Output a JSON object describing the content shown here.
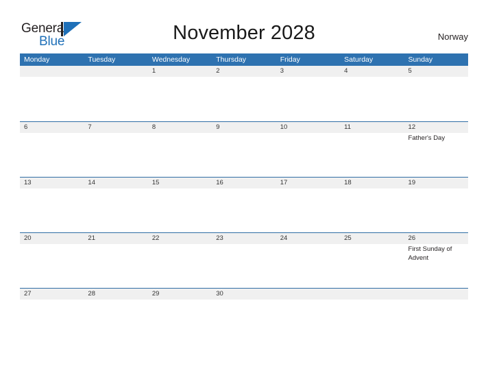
{
  "brand": {
    "name_part1": "General",
    "name_part2": "Blue",
    "logo_icon": "flag-triangle-icon"
  },
  "header": {
    "title": "November 2028",
    "country": "Norway"
  },
  "colors": {
    "header_blue": "#2e72b0",
    "row_divider_blue": "#2e6ca4",
    "day_band_gray": "#f0f0f0",
    "brand_blue": "#1f70b8",
    "text_dark": "#231f20"
  },
  "calendar": {
    "weekdays": [
      "Monday",
      "Tuesday",
      "Wednesday",
      "Thursday",
      "Friday",
      "Saturday",
      "Sunday"
    ],
    "weeks": [
      [
        {
          "day": "",
          "event": ""
        },
        {
          "day": "",
          "event": ""
        },
        {
          "day": "1",
          "event": ""
        },
        {
          "day": "2",
          "event": ""
        },
        {
          "day": "3",
          "event": ""
        },
        {
          "day": "4",
          "event": ""
        },
        {
          "day": "5",
          "event": ""
        }
      ],
      [
        {
          "day": "6",
          "event": ""
        },
        {
          "day": "7",
          "event": ""
        },
        {
          "day": "8",
          "event": ""
        },
        {
          "day": "9",
          "event": ""
        },
        {
          "day": "10",
          "event": ""
        },
        {
          "day": "11",
          "event": ""
        },
        {
          "day": "12",
          "event": "Father's Day"
        }
      ],
      [
        {
          "day": "13",
          "event": ""
        },
        {
          "day": "14",
          "event": ""
        },
        {
          "day": "15",
          "event": ""
        },
        {
          "day": "16",
          "event": ""
        },
        {
          "day": "17",
          "event": ""
        },
        {
          "day": "18",
          "event": ""
        },
        {
          "day": "19",
          "event": ""
        }
      ],
      [
        {
          "day": "20",
          "event": ""
        },
        {
          "day": "21",
          "event": ""
        },
        {
          "day": "22",
          "event": ""
        },
        {
          "day": "23",
          "event": ""
        },
        {
          "day": "24",
          "event": ""
        },
        {
          "day": "25",
          "event": ""
        },
        {
          "day": "26",
          "event": "First Sunday of Advent"
        }
      ],
      [
        {
          "day": "27",
          "event": ""
        },
        {
          "day": "28",
          "event": ""
        },
        {
          "day": "29",
          "event": ""
        },
        {
          "day": "30",
          "event": ""
        },
        {
          "day": "",
          "event": ""
        },
        {
          "day": "",
          "event": ""
        },
        {
          "day": "",
          "event": ""
        }
      ]
    ]
  }
}
